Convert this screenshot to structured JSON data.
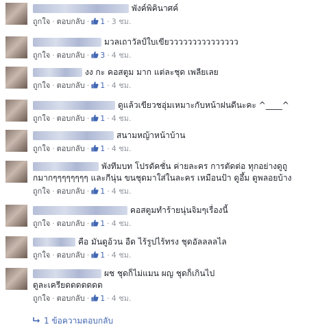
{
  "comments": [
    {
      "author": "▒▒▒▒▒▒▒▒▒▒▒▒▒▒▒",
      "text": "พังค์พิคินาศค์",
      "like_label": "ถูกใจ",
      "reply_label": "ตอบกลับ",
      "likes": "1",
      "time": "3 ชม."
    },
    {
      "author": "▒▒▒▒▒▒▒▒▒▒▒▒",
      "text": "มวลเถาวัลป์ใบเขียววววววววววววววว",
      "like_label": "ถูกใจ",
      "reply_label": "ตอบกลับ",
      "likes": "3",
      "time": "4 ชม."
    },
    {
      "author": "▒▒▒▒▒▒▒▒▒▒▒",
      "text": "งง กะ คอสตูม มาก แต่ละชุด เพลียเลย",
      "like_label": "ถูกใจ",
      "reply_label": "ตอบกลับ",
      "likes": "1",
      "time": "4 ชม."
    },
    {
      "author": "▒▒▒▒▒▒▒▒▒▒▒▒▒▒▒▒▒▒▒",
      "text": "ดูแล้วเขียวชอุ่มเหมาะกับหน้าฝนดีนะคะ ^____^",
      "like_label": "ถูกใจ",
      "reply_label": "ตอบกลับ",
      "likes": "1",
      "time": "4 ชม."
    },
    {
      "author": "▒▒▒▒▒▒▒▒▒▒▒▒▒▒▒▒▒▒",
      "text": "สนามหญ้าหน้าบ้าน",
      "like_label": "ถูกใจ",
      "reply_label": "ตอบกลับ",
      "likes": "1",
      "time": "4 ชม."
    },
    {
      "author": "▒▒▒▒▒▒▒▒▒▒▒",
      "text": "พังทีมบท โปรดัคชั่น ค่ายละคร การตัดต่อ ทุกอย่างดูถู",
      "text2": "กมากๆๆๆๆๆๆๆๆ และกีนุ่น ขนชุดมาใส่ในละคร เหมือนป้า ดูอึ้ม ดูพลอยบ้าง",
      "like_label": "ถูกใจ",
      "reply_label": "ตอบกลับ",
      "likes": "1",
      "time": "4 ชม."
    },
    {
      "author": "▒▒▒▒▒▒▒▒▒▒▒▒▒▒▒▒▒▒▒",
      "text": "คอสตูมทำร้ายนุ่นจิมๆเรื่องนี้",
      "like_label": "ถูกใจ",
      "reply_label": "ตอบกลับ",
      "likes": "1",
      "time": "4 ชม."
    },
    {
      "author": "▒▒▒▒▒▒▒▒▒▒",
      "text": "คือ มันดูอ้วน อืด ไร้รูปไร้ทรง ชุดอัลลลลไล",
      "like_label": "ถูกใจ",
      "reply_label": "ตอบกลับ",
      "likes": "1",
      "time": "4 ชม."
    },
    {
      "author": "▒▒▒▒▒▒▒▒▒▒▒▒▒▒▒▒▒▒▒▒",
      "text": "ผช ชุดก็ไม่แมน ผญ ชุดก็เกินไป",
      "text2": "ดูละเครียดดดดดดด",
      "like_label": "ถูกใจ",
      "reply_label": "ตอบกลับ",
      "likes": "1",
      "time": "4 ชม."
    }
  ],
  "more_replies": "1 ข้อความตอบกลับ",
  "colors": {
    "link": "#4267b2",
    "meta": "#90949c",
    "text": "#1d2129"
  }
}
